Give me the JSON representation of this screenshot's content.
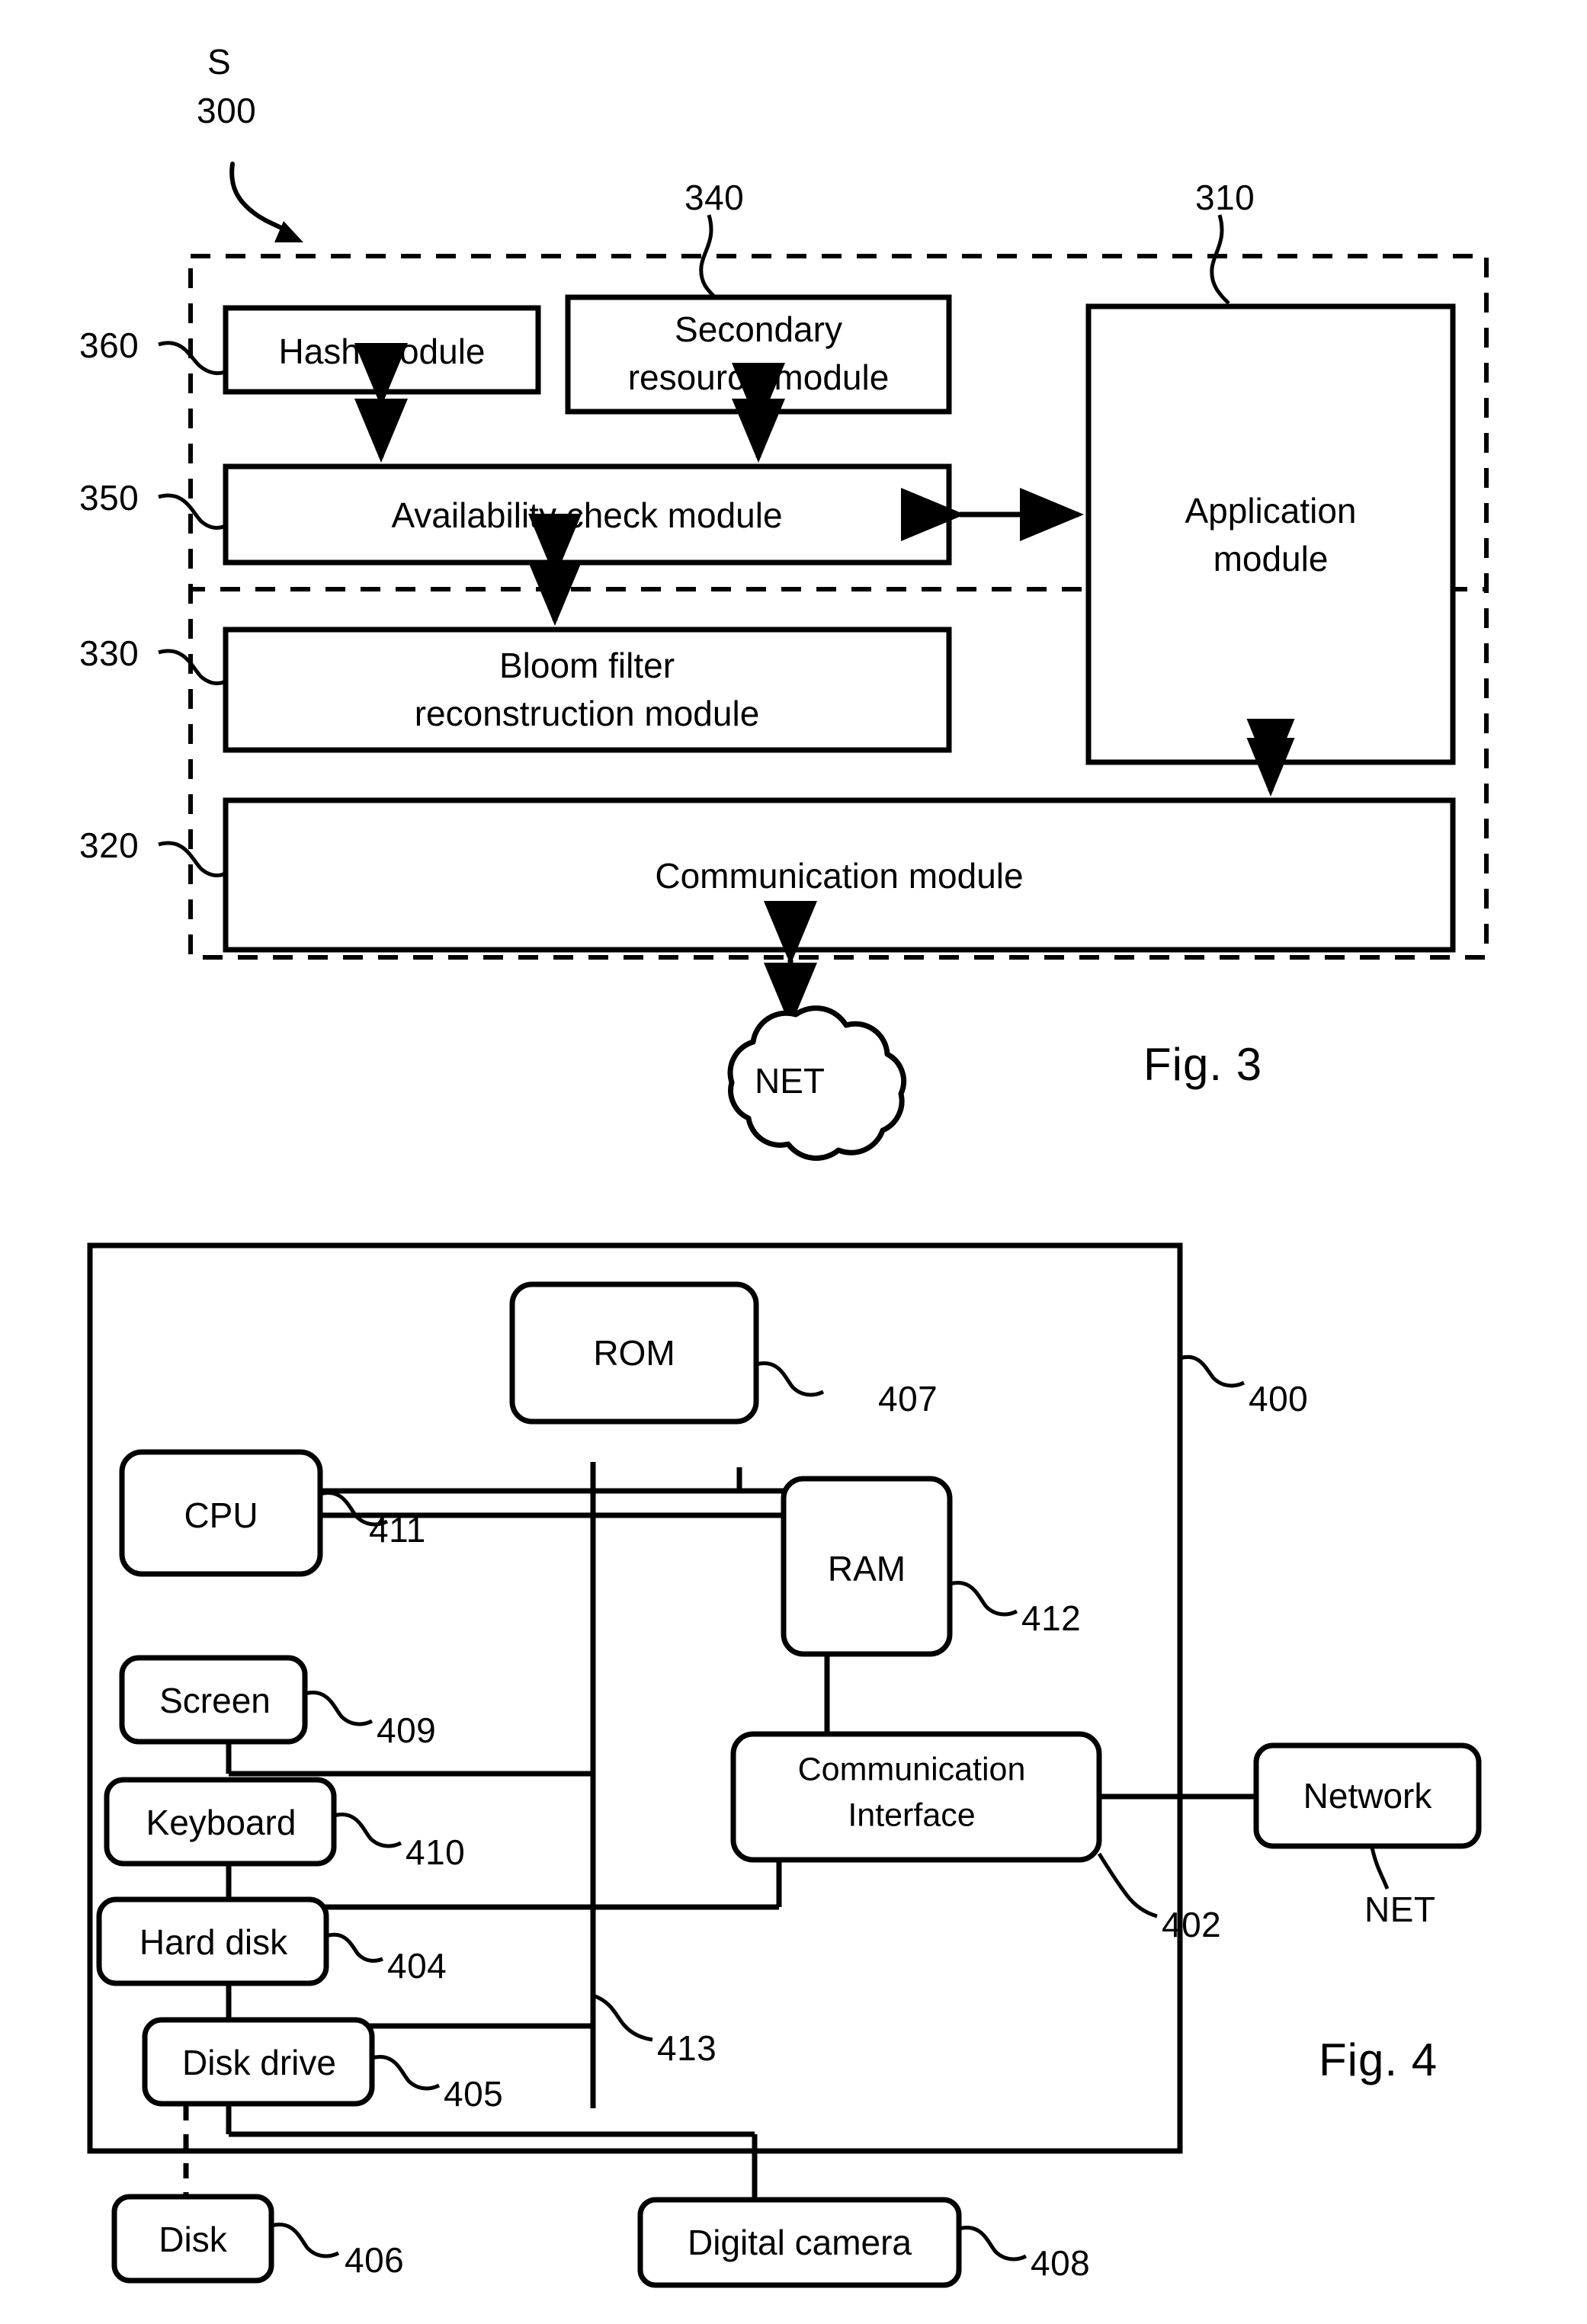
{
  "figures": [
    {
      "id": "fig3",
      "caption": "Fig. 3",
      "system_label": "S",
      "system_ref": "300",
      "boundary": "dashed",
      "blocks": [
        {
          "ref": "360",
          "label": "Hash module"
        },
        {
          "ref": "340",
          "label": "Secondary\nresource module"
        },
        {
          "ref": "310",
          "label": "Application\nmodule"
        },
        {
          "ref": "350",
          "label": "Availability check module"
        },
        {
          "ref": "330",
          "label": "Bloom filter\nreconstruction module"
        },
        {
          "ref": "320",
          "label": "Communication module"
        }
      ],
      "cloud": {
        "label": "NET"
      }
    },
    {
      "id": "fig4",
      "caption": "Fig. 4",
      "device_ref": "400",
      "bus_ref": "413",
      "blocks": [
        {
          "ref": "407",
          "label": "ROM"
        },
        {
          "ref": "411",
          "label": "CPU"
        },
        {
          "ref": "412",
          "label": "RAM"
        },
        {
          "ref": "409",
          "label": "Screen"
        },
        {
          "ref": "410",
          "label": "Keyboard"
        },
        {
          "ref": "404",
          "label": "Hard disk"
        },
        {
          "ref": "405",
          "label": "Disk drive"
        },
        {
          "ref": "406",
          "label": "Disk"
        },
        {
          "ref": "402",
          "label": "Communication\nInterface"
        },
        {
          "ref": "408",
          "label": "Digital camera"
        }
      ],
      "network": {
        "label": "Network",
        "ref": "NET"
      }
    }
  ],
  "fig3": {
    "system_label": "S",
    "system_ref": "300",
    "caption": "Fig. 3",
    "hash_module": {
      "label": "Hash module",
      "ref": "360"
    },
    "secondary_resource_module": {
      "label_line1": "Secondary",
      "label_line2": "resource module",
      "ref": "340"
    },
    "application_module": {
      "label_line1": "Application",
      "label_line2": "module",
      "ref": "310"
    },
    "availability_check_module": {
      "label": "Availability check module",
      "ref": "350"
    },
    "bloom_filter_module": {
      "label_line1": "Bloom filter",
      "label_line2": "reconstruction module",
      "ref": "330"
    },
    "communication_module": {
      "label": "Communication module",
      "ref": "320"
    },
    "net_cloud": {
      "label": "NET"
    }
  },
  "fig4": {
    "caption": "Fig. 4",
    "device_ref": "400",
    "bus_ref": "413",
    "rom": {
      "label": "ROM",
      "ref": "407"
    },
    "cpu": {
      "label": "CPU",
      "ref": "411"
    },
    "ram": {
      "label": "RAM",
      "ref": "412"
    },
    "screen": {
      "label": "Screen",
      "ref": "409"
    },
    "keyboard": {
      "label": "Keyboard",
      "ref": "410"
    },
    "hard_disk": {
      "label": "Hard disk",
      "ref": "404"
    },
    "disk_drive": {
      "label": "Disk drive",
      "ref": "405"
    },
    "disk": {
      "label": "Disk",
      "ref": "406"
    },
    "comm_interface": {
      "label_line1": "Communication",
      "label_line2": "Interface",
      "ref": "402"
    },
    "network": {
      "label": "Network",
      "ref": "NET"
    },
    "digital_camera": {
      "label": "Digital camera",
      "ref": "408"
    }
  },
  "colors": {
    "ink": "#000000",
    "paper": "#ffffff"
  }
}
